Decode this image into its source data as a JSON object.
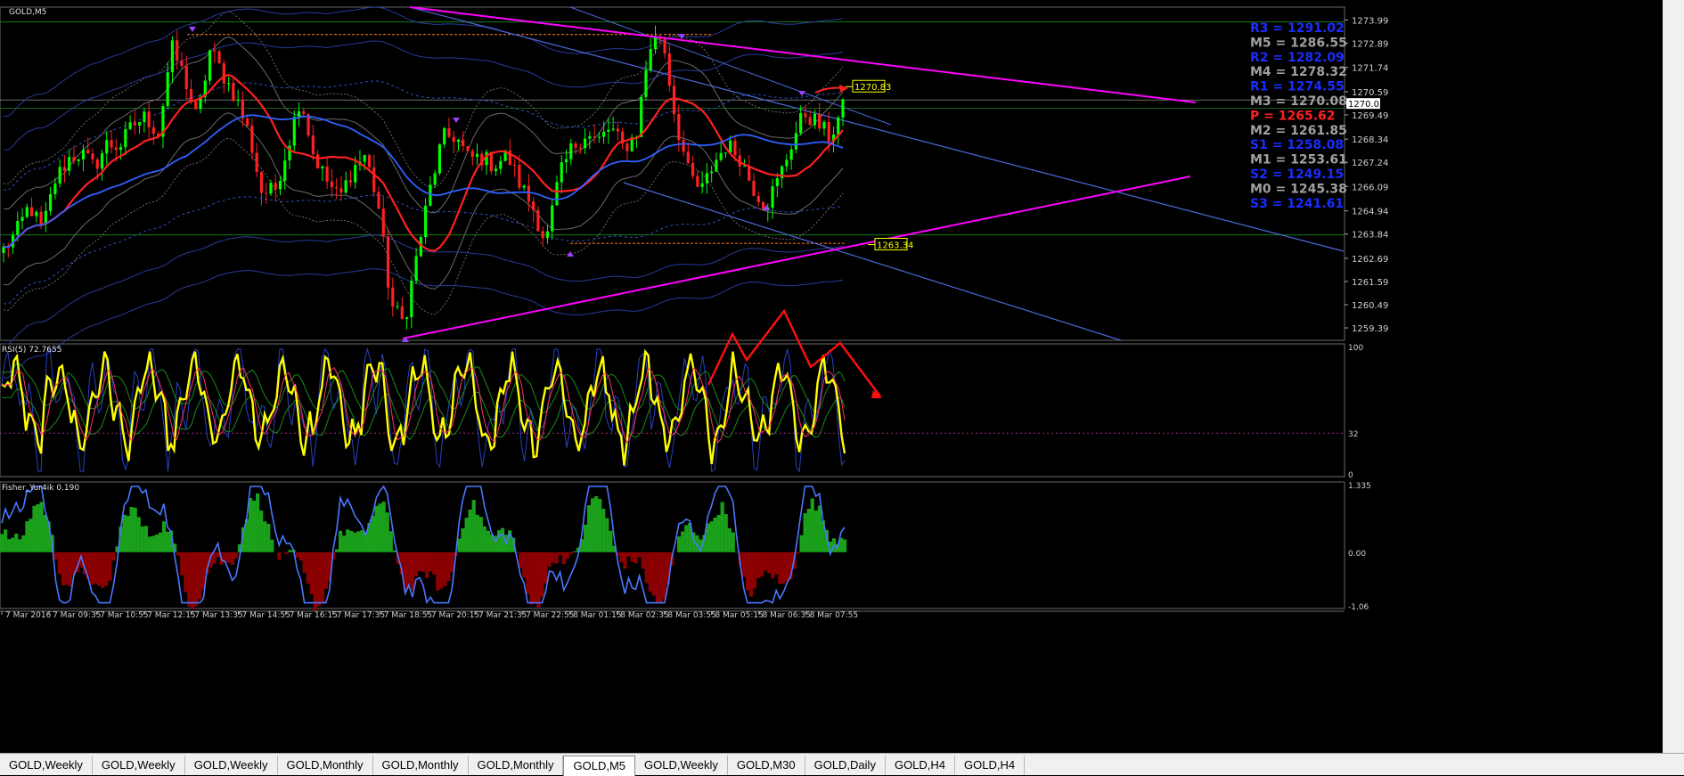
{
  "window": {
    "symbol_label": "GOLD,M5"
  },
  "tabs": [
    {
      "label": "GOLD,Weekly",
      "active": false
    },
    {
      "label": "GOLD,Weekly",
      "active": false
    },
    {
      "label": "GOLD,Weekly",
      "active": false
    },
    {
      "label": "GOLD,Monthly",
      "active": false
    },
    {
      "label": "GOLD,Monthly",
      "active": false
    },
    {
      "label": "GOLD,Monthly",
      "active": false
    },
    {
      "label": "GOLD,M5",
      "active": true
    },
    {
      "label": "GOLD,Weekly",
      "active": false
    },
    {
      "label": "GOLD,M30",
      "active": false
    },
    {
      "label": "GOLD,Daily",
      "active": false
    },
    {
      "label": "GOLD,H4",
      "active": false
    },
    {
      "label": "GOLD,H4",
      "active": false
    }
  ],
  "colors": {
    "background": "#000000",
    "bull_candle": "#00ff00",
    "bear_candle": "#ff2020",
    "ma_red": "#ff2020",
    "ma_blue": "#3060ff",
    "trendline_magenta": "#ff00ff",
    "channel_blue": "#4a6ad8",
    "pivot_blue": "#1a2cff",
    "pivot_grey": "#a0a0a0",
    "pivot_red": "#ff2020",
    "rsi_yellow": "#ffff00",
    "fisher_green": "#1aa01a",
    "fisher_red": "#8b0000",
    "fisher_line": "#4a78ff",
    "grid": "#505050"
  },
  "chart_data": [
    {
      "type": "candlestick",
      "name": "GOLD,M5",
      "ylim": [
        1258.8,
        1274.6
      ],
      "price_ticks": [
        "1273.99",
        "1272.89",
        "1271.74",
        "1270.59",
        "1269.49",
        "1268.34",
        "1267.24",
        "1266.09",
        "1264.94",
        "1263.84",
        "1262.69",
        "1261.59",
        "1260.49",
        "1259.39"
      ],
      "current_price": "1270.03",
      "x_tick_labels": [
        "7 Mar 2016",
        "7 Mar 09:35",
        "7 Mar 10:55",
        "7 Mar 12:15",
        "7 Mar 13:35",
        "7 Mar 14:55",
        "7 Mar 16:15",
        "7 Mar 17:35",
        "7 Mar 18:55",
        "7 Mar 20:15",
        "7 Mar 21:35",
        "7 Mar 22:55",
        "8 Mar 01:15",
        "8 Mar 02:35",
        "8 Mar 03:55",
        "8 Mar 05:15",
        "8 Mar 06:35",
        "8 Mar 07:55"
      ],
      "close_path": [
        1263.1,
        1263.9,
        1265.2,
        1264.0,
        1266.4,
        1267.4,
        1267.7,
        1267.0,
        1268.1,
        1268.0,
        1269.0,
        1269.4,
        1268.6,
        1272.7,
        1271.3,
        1269.2,
        1272.6,
        1271.4,
        1270.3,
        1268.6,
        1265.8,
        1265.9,
        1268.0,
        1270.4,
        1267.6,
        1266.4,
        1265.5,
        1266.9,
        1267.6,
        1265.3,
        1260.5,
        1259.6,
        1262.8,
        1265.9,
        1268.4,
        1268.5,
        1267.4,
        1267.5,
        1267.1,
        1267.6,
        1266.2,
        1265.1,
        1263.4,
        1266.5,
        1267.9,
        1268.6,
        1268.2,
        1268.9,
        1267.9,
        1268.6,
        1272.7,
        1273.3,
        1269.4,
        1266.8,
        1265.8,
        1267.2,
        1268.1,
        1267.5,
        1266.1,
        1265.2,
        1266.4,
        1268.1,
        1269.6,
        1269.1,
        1268.4,
        1269.8
      ],
      "pivots": [
        {
          "label": "R3 = 1291.02",
          "color": "#1a2cff"
        },
        {
          "label": "M5 = 1286.55",
          "color": "#a0a0a0"
        },
        {
          "label": "R2 = 1282.09",
          "color": "#1a2cff"
        },
        {
          "label": "M4 = 1278.32",
          "color": "#a0a0a0"
        },
        {
          "label": "R1 = 1274.55",
          "color": "#1a2cff"
        },
        {
          "label": "M3 = 1270.08",
          "color": "#a0a0a0"
        },
        {
          "label": "P   = 1265.62",
          "color": "#ff2020"
        },
        {
          "label": "M2 = 1261.85",
          "color": "#a0a0a0"
        },
        {
          "label": "S1 = 1258.08",
          "color": "#1a2cff"
        },
        {
          "label": "M1 = 1253.61",
          "color": "#a0a0a0"
        },
        {
          "label": "S2 = 1249.15",
          "color": "#1a2cff"
        },
        {
          "label": "M0 = 1245.38",
          "color": "#a0a0a0"
        },
        {
          "label": "S3 = 1241.61",
          "color": "#1a2cff"
        }
      ],
      "annotations": [
        {
          "text": "1270.83",
          "price": 1270.83
        },
        {
          "text": "1263.34",
          "price": 1263.34
        }
      ]
    },
    {
      "type": "line",
      "name": "RSI(5) 72.7655",
      "ylim": [
        0,
        100
      ],
      "ticks": [
        "100",
        "32",
        "0"
      ],
      "level": 32
    },
    {
      "type": "histogram",
      "name": "Fisher_Yur4ik 0.190",
      "ylim": [
        -1.06,
        1.335
      ],
      "ticks": [
        "1.335",
        "0.00",
        "-1.06"
      ]
    }
  ]
}
